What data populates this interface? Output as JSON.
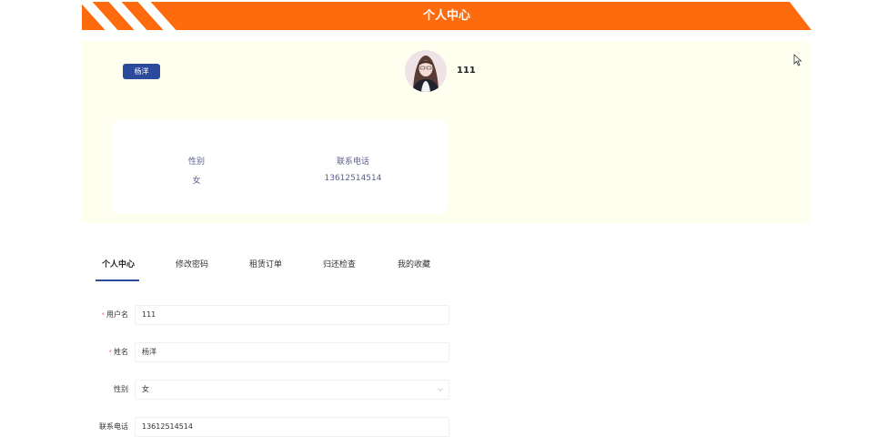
{
  "header": {
    "title": "个人中心"
  },
  "profile": {
    "name_badge": "杨洋",
    "username": "111",
    "gender_label": "性别",
    "gender_value": "女",
    "phone_label": "联系电话",
    "phone_value": "13612514514"
  },
  "tabs": [
    {
      "label": "个人中心",
      "active": true
    },
    {
      "label": "修改密码",
      "active": false
    },
    {
      "label": "租赁订单",
      "active": false
    },
    {
      "label": "归还检查",
      "active": false
    },
    {
      "label": "我的收藏",
      "active": false
    }
  ],
  "form": {
    "username": {
      "label": "用户名",
      "value": "111",
      "required": "*"
    },
    "name": {
      "label": "姓名",
      "value": "杨洋",
      "required": "*"
    },
    "gender": {
      "label": "性别",
      "value": "女"
    },
    "phone": {
      "label": "联系电话",
      "value": "13612514514"
    }
  },
  "colors": {
    "banner": "#fd6b0e",
    "accent": "#2b4a9c",
    "panel": "#fffff0"
  },
  "icons": {
    "avatar": "avatar-photo",
    "cursor": "mouse-cursor-icon",
    "select": "chevron-down-icon"
  }
}
